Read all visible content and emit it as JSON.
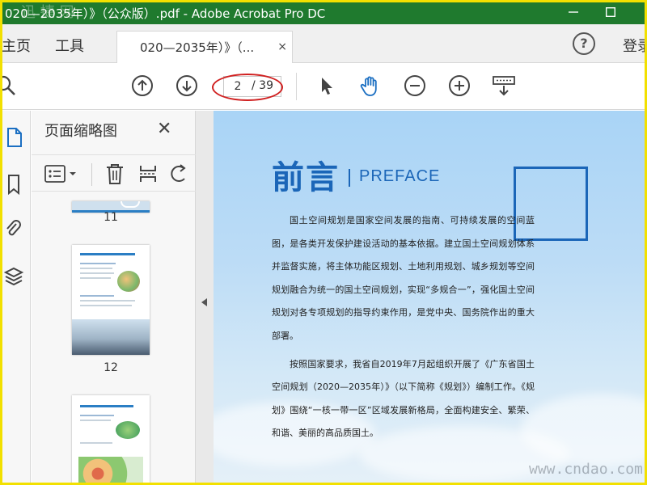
{
  "titlebar": {
    "title": "020—2035年）》（公众版）.pdf - Adobe Acrobat Pro DC",
    "watermark_text": "迅 捷 网",
    "bg_color": "#1f7a2e"
  },
  "tabbar": {
    "home_label": "主页",
    "tools_label": "工具",
    "doc_tab_label": "020—2035年）》（...",
    "doc_tab_close": "×",
    "help_label": "?",
    "login_label": "登录"
  },
  "toolbar": {
    "current_page": "2",
    "total_pages": "/ 39",
    "icons": [
      "search-icon",
      "prev-page-icon",
      "next-page-icon",
      "select-arrow-icon",
      "hand-tool-icon",
      "zoom-out-icon",
      "zoom-in-icon",
      "keyboard-icon"
    ]
  },
  "panel": {
    "title": "页面缩略图",
    "close_label": "✕",
    "thumbnails": [
      {
        "label": "11"
      },
      {
        "label": "12"
      },
      {
        "label": ""
      }
    ]
  },
  "document": {
    "heading": "前言",
    "subheading": "PREFACE",
    "paragraphs": [
      "国土空间规划是国家空间发展的指南、可持续发展的空间蓝图，是各类开发保护建设活动的基本依据。建立国土空间规划体系并监督实施，将主体功能区规划、土地利用规划、城乡规划等空间规划融合为统一的国土空间规划，实现“多规合一”，强化国土空间规划对各专项规划的指导约束作用，是党中央、国务院作出的重大部署。",
      "按照国家要求，我省自2019年7月起组织开展了《广东省国土空间规划（2020—2035年）》（以下简称《规划》）编制工作。《规划》围绕“一核一带一区”区域发展新格局，全面构建安全、繁荣、和谐、美丽的高品质国土。"
    ]
  },
  "footer_watermark": "www.cndao.com",
  "colors": {
    "accent_blue": "#1b66b8",
    "highlight_red": "#d02020",
    "frame_yellow": "#f2e000"
  }
}
